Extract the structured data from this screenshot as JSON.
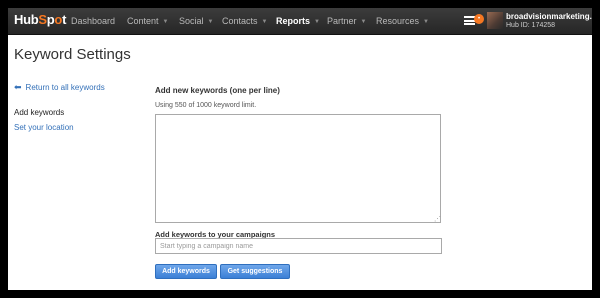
{
  "nav": {
    "logo": "HubSpot",
    "items": [
      {
        "label": "Dashboard",
        "has_caret": false,
        "active": false
      },
      {
        "label": "Content",
        "has_caret": true,
        "active": false
      },
      {
        "label": "Social",
        "has_caret": true,
        "active": false
      },
      {
        "label": "Contacts",
        "has_caret": true,
        "active": false
      },
      {
        "label": "Reports",
        "has_caret": true,
        "active": true
      },
      {
        "label": "Partner",
        "has_caret": true,
        "active": false
      },
      {
        "label": "Resources",
        "has_caret": true,
        "active": false
      }
    ],
    "notification_icon": "menu-icon",
    "account_name": "broadvisionmarketing....",
    "hub_id": "Hub ID: 174258"
  },
  "page": {
    "title": "Keyword Settings"
  },
  "sidebar": {
    "back_link": "Return to all keywords",
    "back_icon": "arrow-left-icon",
    "items": [
      {
        "label": "Add keywords",
        "active": true
      },
      {
        "label": "Set your location",
        "active": false
      }
    ]
  },
  "form": {
    "section_title": "Add new keywords (one per line)",
    "limit_text": "Using 550 of 1000 keyword limit.",
    "keywords_value": "",
    "campaign_label": "Add keywords to your campaigns",
    "campaign_placeholder": "Start typing a campaign name",
    "add_button": "Add keywords",
    "suggest_button": "Get suggestions"
  },
  "colors": {
    "accent": "#f57722",
    "link": "#3370b8",
    "button": "#3b7fd6"
  }
}
